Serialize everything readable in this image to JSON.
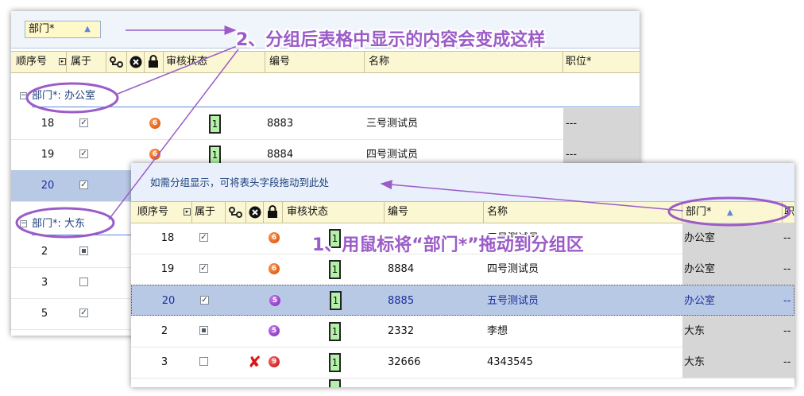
{
  "annotations": {
    "step2": "2、分组后表格中显示的内容会变成这样",
    "step1": "1、用鼠标将“部门*”拖动到分组区"
  },
  "back_panel": {
    "group_chip": {
      "label": "部门*",
      "arrow": "▲"
    },
    "headers": {
      "seq": "顺序号",
      "belong": "属于",
      "status": "审核状态",
      "code": "编号",
      "name": "名称",
      "position": "职位*"
    },
    "groups": [
      {
        "label": "部门*: 办公室",
        "toggle": "−"
      },
      {
        "label": "部门*: 大东",
        "toggle": "−"
      }
    ],
    "rows_office": [
      {
        "seq": "18",
        "check": "☑",
        "ball": "6",
        "status": "1",
        "code": "8883",
        "name": "三号测试员",
        "position": "---"
      },
      {
        "seq": "19",
        "check": "☑",
        "ball": "6",
        "status": "1",
        "code": "8884",
        "name": "四号测试员",
        "position": "---"
      },
      {
        "seq": "20",
        "check": "☑"
      }
    ],
    "rows_dadong": [
      {
        "seq": "2"
      },
      {
        "seq": "3"
      },
      {
        "seq": "5"
      }
    ]
  },
  "front_panel": {
    "hint": "如需分组显示，可将表头字段拖动到此处",
    "headers": {
      "seq": "顺序号",
      "belong": "属于",
      "status": "审核状态",
      "code": "编号",
      "name": "名称",
      "dept": "部门*",
      "dept_arrow": "▲",
      "extra": "职"
    },
    "rows": [
      {
        "seq": "18",
        "ball": "6",
        "status": "1",
        "code": "",
        "name": "三号测试员",
        "dept": "办公室",
        "pos": "--"
      },
      {
        "seq": "19",
        "ball": "6",
        "status": "1",
        "code": "8884",
        "name": "四号测试员",
        "dept": "办公室",
        "pos": "--"
      },
      {
        "seq": "20",
        "ball": "5",
        "status": "1",
        "code": "8885",
        "name": "五号测试员",
        "dept": "办公室",
        "pos": "--"
      },
      {
        "seq": "2",
        "ball": "5",
        "status": "1",
        "code": "2332",
        "name": "李想",
        "dept": "大东",
        "pos": "--"
      },
      {
        "seq": "3",
        "ball": "9",
        "status": "1",
        "code": "32666",
        "name": "4343545",
        "dept": "大东",
        "pos": "--",
        "x": "✘"
      }
    ]
  },
  "icons": {
    "check": "☑",
    "tick": "✓"
  },
  "colors": {
    "annotation": "#9b5cc8",
    "header_bg": "#fbf7d2",
    "selected_row": "#b8c9e6",
    "group_text": "#1b3f7a"
  }
}
